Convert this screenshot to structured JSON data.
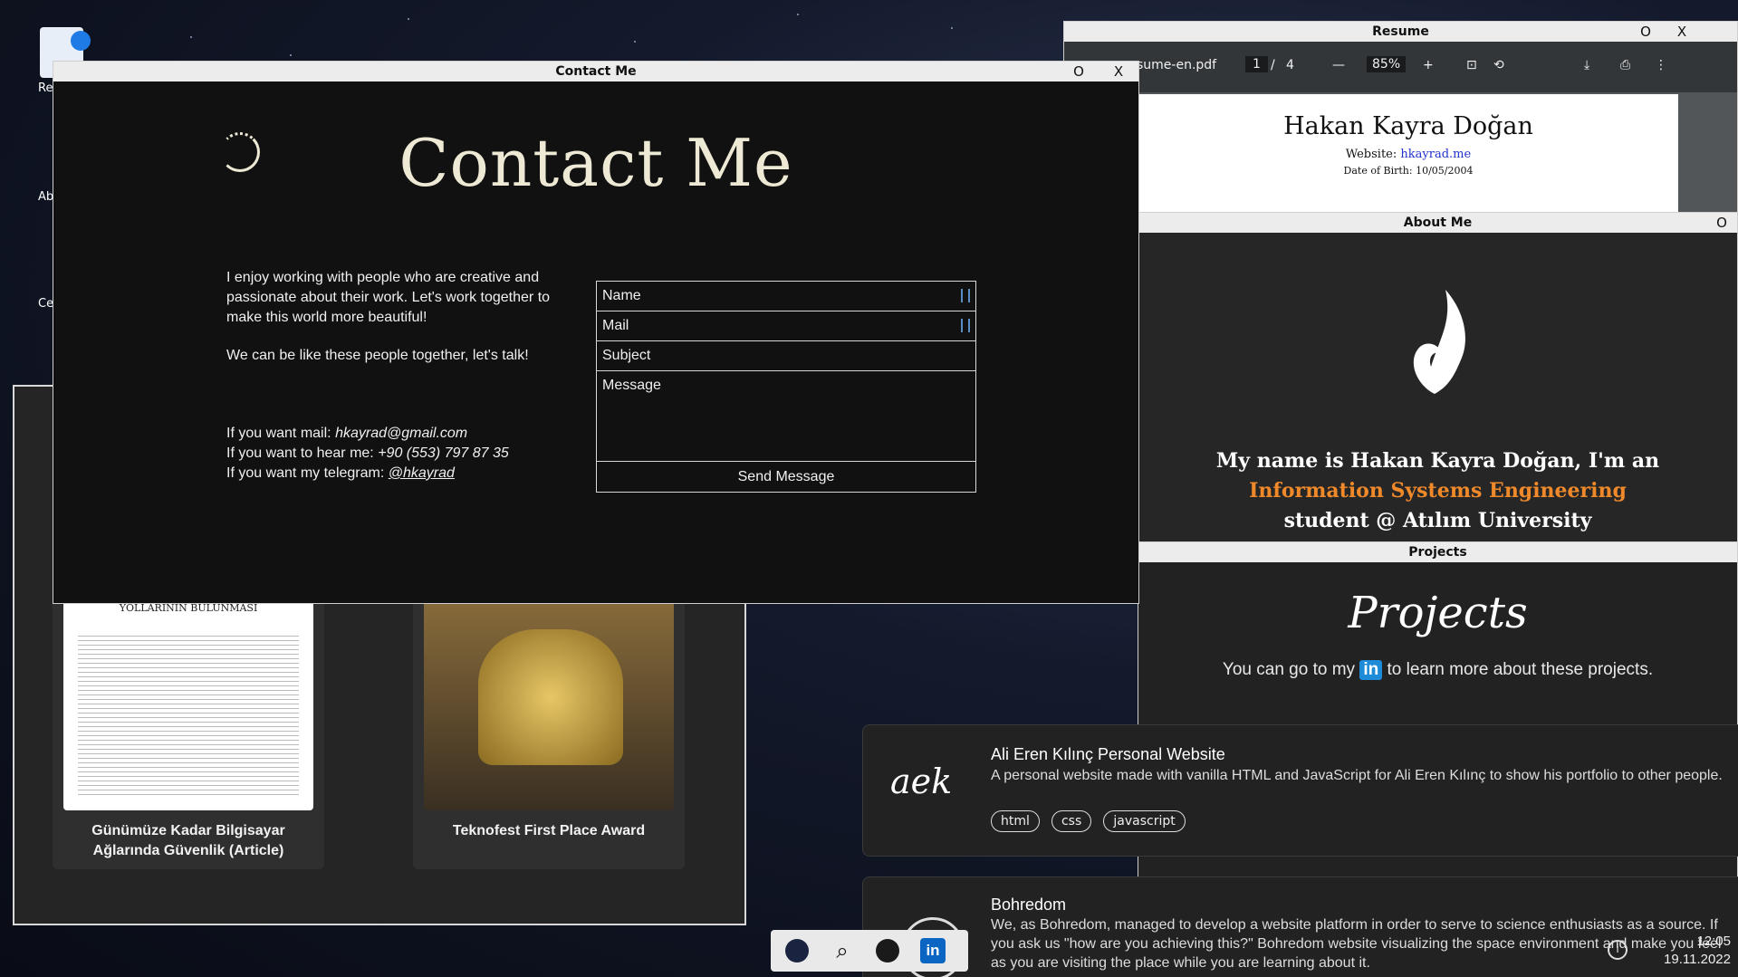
{
  "desktop": {
    "icons": [
      {
        "label": "Re"
      },
      {
        "label": "Abo"
      },
      {
        "label": "Cert"
      }
    ]
  },
  "cert_window": {
    "cards": [
      {
        "doc_heading": "YOLLARININ BULUNMASI",
        "caption": "Günümüze Kadar Bilgisayar Ağlarında Güvenlik (Article)"
      },
      {
        "caption": "Teknofest First Place Award"
      }
    ]
  },
  "resume_window": {
    "title": "Resume",
    "restore": "O",
    "close": "X",
    "file_name": "sume-en.pdf",
    "page_current": "1",
    "page_sep": "/",
    "page_total": "4",
    "zoom": "85%",
    "pdf": {
      "name": "Hakan Kayra Doğan",
      "website_label": "Website:",
      "website": "hkayrad.me",
      "dob": "Date of Birth: 10/05/2004"
    }
  },
  "about_window": {
    "title": "About Me",
    "restore": "O",
    "intro_line1": "My name is Hakan Kayra Doğan, I'm an",
    "intro_accent": "Information Systems Engineering",
    "intro_line3": "student @ Atılım University",
    "accent_color": "#f0892a"
  },
  "projects_window": {
    "title": "Projects",
    "heading": "Projects",
    "sub_before": "You can go to my",
    "sub_badge": "in",
    "sub_after": "to learn more about these projects.",
    "projects": [
      {
        "logo": "aek",
        "title": "Ali Eren Kılınç Personal Website",
        "description": "A personal website made with vanilla HTML and JavaScript for Ali Eren Kılınç to show his portfolio to other people.",
        "tags": [
          "html",
          "css",
          "javascript"
        ]
      },
      {
        "title": "Bohredom",
        "description": "We, as Bohredom, managed to develop a website platform in order to serve to science enthusiasts as a source. If you ask us \"how are you achieving this?\" Bohredom website visualizing the space environment and make you feel as you are visiting the place while you are learning about it."
      }
    ]
  },
  "contact_window": {
    "title": "Contact Me",
    "restore": "O",
    "close": "X",
    "heading": "Contact Me",
    "paragraph1": "I enjoy working with people who are creative and passionate about their work. Let's work together to make this world more beautiful!",
    "paragraph2": "We can be like these people together, let's talk!",
    "mail_label": "If you want mail:",
    "mail_value": "hkayrad@gmail.com",
    "phone_label": "If you want to hear me:",
    "phone_value": "+90 (553) 797 87 35",
    "telegram_label": "If you want my telegram:",
    "telegram_value": "@hkayrad",
    "form": {
      "name": "Name",
      "mail": "Mail",
      "subject": "Subject",
      "message": "Message",
      "send": "Send Message"
    }
  },
  "taskbar": {
    "icons": [
      "bird-logo-icon",
      "search-icon",
      "github-icon",
      "linkedin-icon"
    ],
    "linkedin_text": "in"
  },
  "clock": {
    "time": "12:05",
    "date": "19.11.2022"
  }
}
